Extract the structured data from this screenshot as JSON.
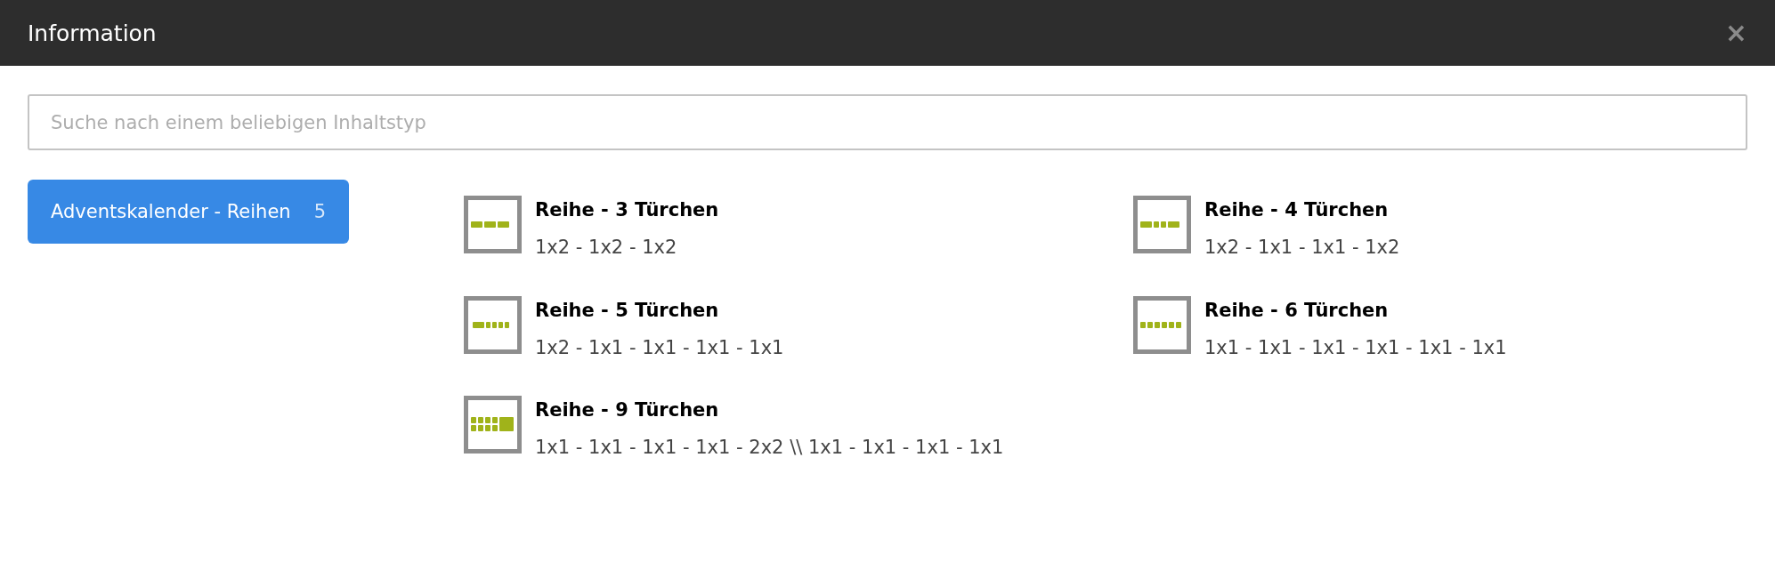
{
  "window": {
    "title": "Information",
    "close": "×"
  },
  "search": {
    "placeholder": "Suche nach einem beliebigen Inhaltstyp"
  },
  "categories": [
    {
      "label": "Adventskalender - Reihen",
      "count": "5",
      "selected": true
    }
  ],
  "items": [
    {
      "title": "Reihe - 3 Türchen",
      "description": "1x2 - 1x2 - 1x2"
    },
    {
      "title": "Reihe - 4 Türchen",
      "description": "1x2 - 1x1 - 1x1 - 1x2"
    },
    {
      "title": "Reihe - 5 Türchen",
      "description": "1x2 - 1x1 - 1x1 - 1x1 - 1x1"
    },
    {
      "title": "Reihe - 6 Türchen",
      "description": "1x1 - 1x1 - 1x1 - 1x1 - 1x1 - 1x1"
    },
    {
      "title": "Reihe - 9 Türchen",
      "description": "1x1 - 1x1 - 1x1 - 1x1 - 2x2 \\\\ 1x1 - 1x1 - 1x1 - 1x1"
    }
  ]
}
